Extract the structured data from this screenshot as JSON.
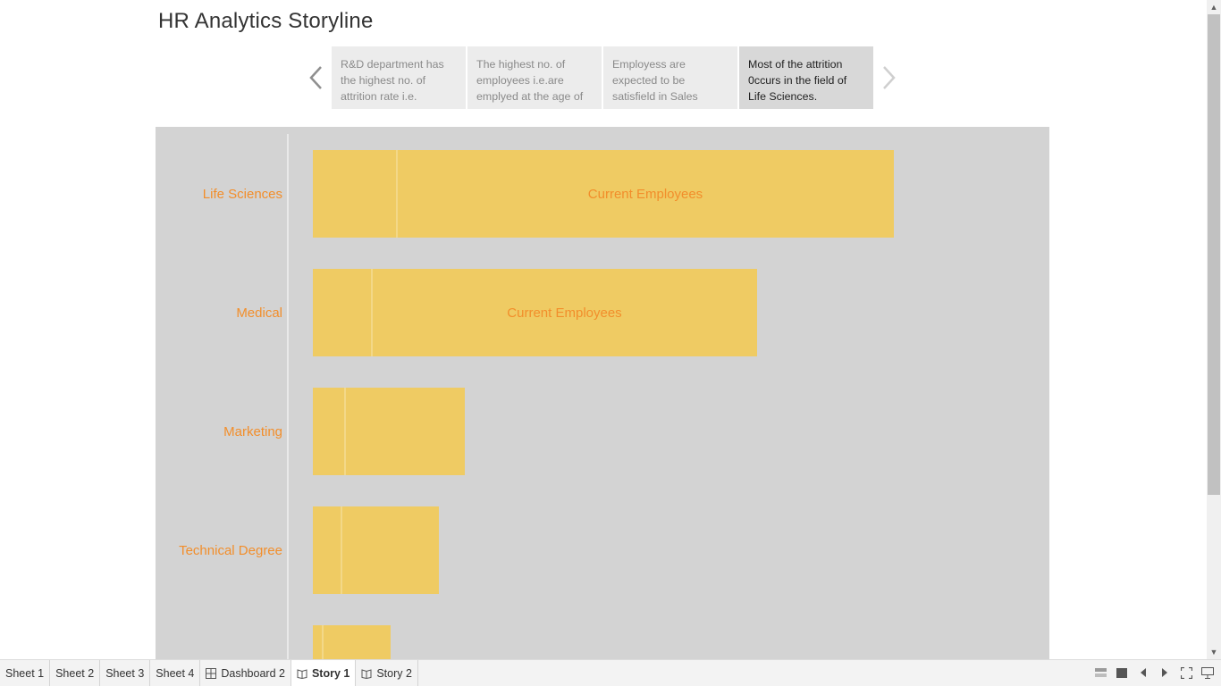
{
  "story": {
    "title": "HR Analytics Storyline"
  },
  "story_points": [
    {
      "text": "R&D department has the highest no. of attrition rate i.e.",
      "active": false
    },
    {
      "text": "The highest no. of employees i.e.are emplyed at the age of",
      "active": false
    },
    {
      "text": "Employess are expected to be satisfield in Sales",
      "active": false
    },
    {
      "text": "Most of the attrition 0ccurs in the field of Life Sciences.",
      "active": true
    }
  ],
  "chart_data": {
    "type": "bar",
    "orientation": "horizontal",
    "stacked": true,
    "categories": [
      "Life Sciences",
      "Medical",
      "Marketing",
      "Technical Degree",
      ""
    ],
    "series": [
      {
        "name": "",
        "values": [
          94,
          66,
          36,
          32,
          11
        ]
      },
      {
        "name": "Current Employees",
        "values": [
          556,
          431,
          134,
          109,
          76
        ]
      }
    ],
    "xlim": [
      0,
      800
    ],
    "grid": false,
    "colors": {
      "bar": "#efcb63",
      "label": "#f28e2b",
      "background": "#d3d3d3"
    }
  },
  "sheet_tabs": [
    {
      "label": "Sheet 1",
      "icon": "none",
      "active": false
    },
    {
      "label": "Sheet 2",
      "icon": "none",
      "active": false
    },
    {
      "label": "Sheet 3",
      "icon": "none",
      "active": false
    },
    {
      "label": "Sheet 4",
      "icon": "none",
      "active": false
    },
    {
      "label": "Dashboard 2",
      "icon": "dashboard-icon",
      "active": false
    },
    {
      "label": "Story 1",
      "icon": "story-icon",
      "active": true
    },
    {
      "label": "Story 2",
      "icon": "story-icon",
      "active": false
    }
  ]
}
